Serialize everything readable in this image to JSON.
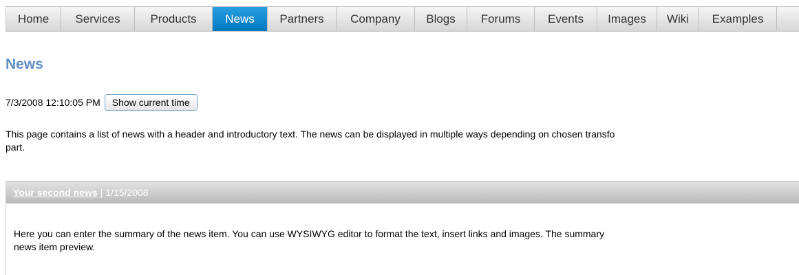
{
  "nav": {
    "items": [
      {
        "label": "Home"
      },
      {
        "label": "Services"
      },
      {
        "label": "Products"
      },
      {
        "label": "News",
        "active": true
      },
      {
        "label": "Partners"
      },
      {
        "label": "Company"
      },
      {
        "label": "Blogs"
      },
      {
        "label": "Forums"
      },
      {
        "label": "Events"
      },
      {
        "label": "Images"
      },
      {
        "label": "Wiki"
      },
      {
        "label": "Examples"
      }
    ]
  },
  "page": {
    "title": "News",
    "datetime": "7/3/2008 12:10:05 PM",
    "show_time_button": "Show current time",
    "intro_line1": "This page contains a list of news with a header and introductory text. The news can be displayed in multiple ways depending on chosen transfo",
    "intro_line2": "part."
  },
  "news": [
    {
      "title": "Your second news",
      "separator": "|",
      "date": "1/15/2008",
      "summary_line1": "Here you can enter the summary of the news item. You can use WYSIWYG editor to format the text, insert links and images. The summary",
      "summary_line2": "news item preview."
    }
  ],
  "colors": {
    "active_tab": "#0a86d0",
    "title": "#5f8fc6",
    "news_header": "#c8c8c8"
  }
}
